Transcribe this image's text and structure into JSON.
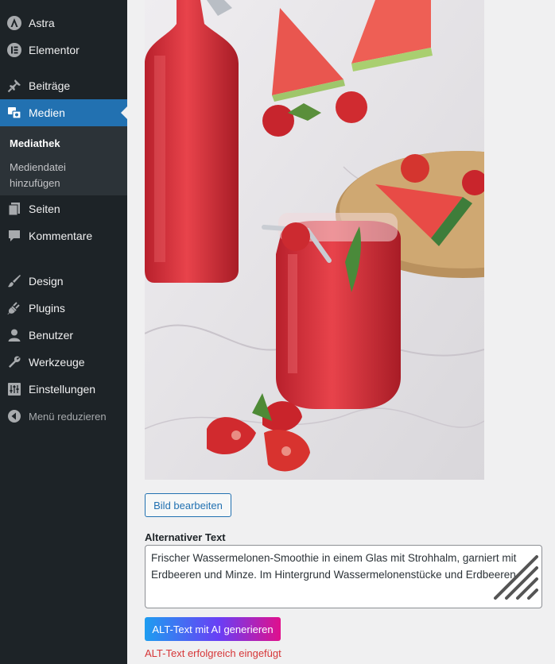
{
  "sidebar": {
    "items": [
      {
        "label": "Astra",
        "icon": "astra-icon"
      },
      {
        "label": "Elementor",
        "icon": "elementor-icon"
      },
      {
        "label": "Beiträge",
        "icon": "pin-icon"
      },
      {
        "label": "Medien",
        "icon": "media-icon"
      },
      {
        "label": "Seiten",
        "icon": "pages-icon"
      },
      {
        "label": "Kommentare",
        "icon": "comment-icon"
      },
      {
        "label": "Design",
        "icon": "brush-icon"
      },
      {
        "label": "Plugins",
        "icon": "plug-icon"
      },
      {
        "label": "Benutzer",
        "icon": "user-icon"
      },
      {
        "label": "Werkzeuge",
        "icon": "wrench-icon"
      },
      {
        "label": "Einstellungen",
        "icon": "settings-icon"
      },
      {
        "label": "Menü reduzieren",
        "icon": "collapse-icon"
      }
    ],
    "active": "Medien",
    "submenu": [
      {
        "label": "Mediathek",
        "current": true
      },
      {
        "label": "Mediendatei hinzufügen",
        "current": false
      }
    ]
  },
  "main": {
    "edit_button": "Bild bearbeiten",
    "alt_text_label": "Alternativer Text",
    "alt_text_value": "Frischer Wassermelonen-Smoothie in einem Glas mit Strohhalm, garniert mit Erdbeeren und Minze. Im Hintergrund Wassermelonenstücke und Erdbeeren.",
    "ai_button": "ALT-Text mit AI generieren",
    "success_message": "ALT-Text erfolgreich eingefügt"
  },
  "colors": {
    "sidebar_bg": "#1d2327",
    "active_bg": "#2271b1",
    "success_text": "#d63638"
  }
}
